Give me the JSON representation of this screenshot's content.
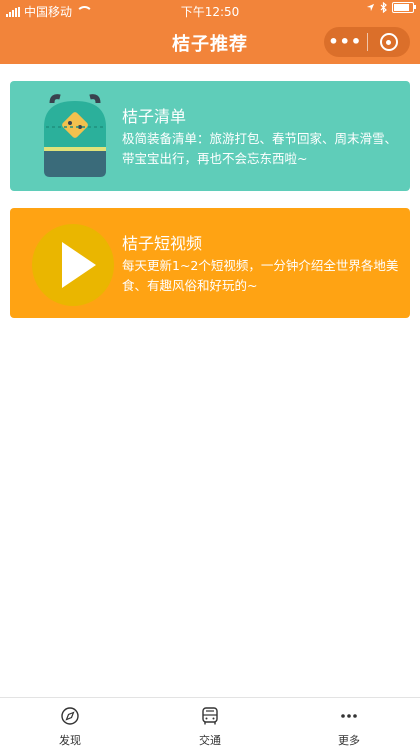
{
  "status_bar": {
    "carrier": "中国移动",
    "time": "下午12:50"
  },
  "nav": {
    "title": "桔子推荐",
    "more_label": "•••",
    "more_icon": "more-dots-icon",
    "close_icon": "capsule-close-icon"
  },
  "cards": [
    {
      "title": "桔子清单",
      "desc": "极简装备清单：旅游打包、春节回家、周末滑雪、带宝宝出行，再也不会忘东西啦~",
      "icon": "backpack-icon",
      "color": "#5fcdb9"
    },
    {
      "title": "桔子短视频",
      "desc": "每天更新1~2个短视频，一分钟介绍全世界各地美食、有趣风俗和好玩的~",
      "icon": "play-icon",
      "color": "#ffa313"
    }
  ],
  "tabbar": [
    {
      "label": "发现",
      "icon": "compass-icon"
    },
    {
      "label": "交通",
      "icon": "bus-icon"
    },
    {
      "label": "更多",
      "icon": "more-dots-icon"
    }
  ],
  "colors": {
    "header": "#f2843a",
    "card_green": "#5fcdb9",
    "card_orange": "#ffa313"
  }
}
